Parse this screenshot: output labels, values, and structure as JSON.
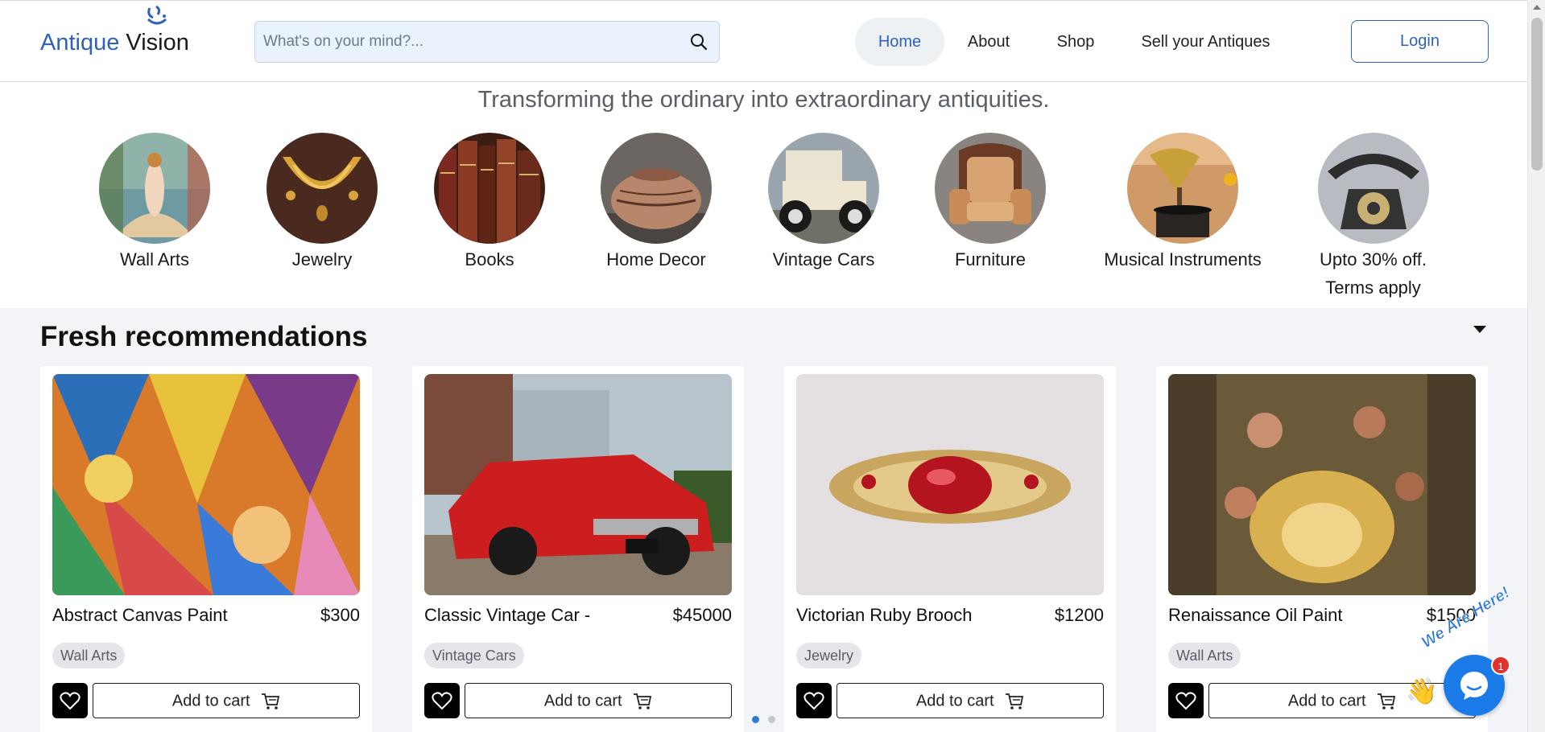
{
  "header": {
    "logo_part1": "Antique",
    "logo_part2": "Vision",
    "search_placeholder": "What's on your mind?...",
    "nav": [
      "Home",
      "About",
      "Shop",
      "Sell your Antiques"
    ],
    "login_label": "Login",
    "accent_color": "#2f63b8"
  },
  "tagline": "Transforming the ordinary into extraordinary antiquities.",
  "categories": [
    {
      "label": "Wall Arts",
      "icon": "venus-painting-image"
    },
    {
      "label": "Jewelry",
      "icon": "gold-necklace-image"
    },
    {
      "label": "Books",
      "icon": "old-books-image"
    },
    {
      "label": "Home Decor",
      "icon": "clay-pot-image"
    },
    {
      "label": "Vintage Cars",
      "icon": "vintage-car-image"
    },
    {
      "label": "Furniture",
      "icon": "armchair-image"
    },
    {
      "label": "Musical Instruments",
      "icon": "gramophone-image"
    },
    {
      "label": "Upto 30% off.",
      "label2": "Terms apply",
      "icon": "rotary-phone-image"
    }
  ],
  "recommendations": {
    "title": "Fresh recommendations",
    "cart_label": "Add to cart",
    "items": [
      {
        "title": "Abstract Canvas Paint",
        "price": "$300",
        "tag": "Wall Arts",
        "image": "abstract-painting-image"
      },
      {
        "title": "Classic Vintage Car -",
        "price": "$45000",
        "tag": "Vintage Cars",
        "image": "red-mustang-image"
      },
      {
        "title": "Victorian Ruby Brooch",
        "price": "$1200",
        "tag": "Jewelry",
        "image": "ruby-brooch-image"
      },
      {
        "title": "Renaissance Oil Paint",
        "price": "$1500",
        "tag": "Wall Arts",
        "image": "renaissance-painting-image"
      }
    ]
  },
  "chat": {
    "callout": "We Are Here!",
    "badge": "1"
  }
}
